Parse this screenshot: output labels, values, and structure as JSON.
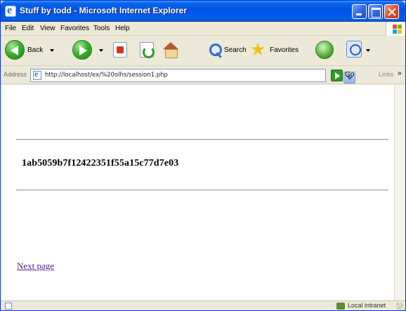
{
  "window": {
    "title": "Stuff by todd - Microsoft Internet Explorer"
  },
  "menu": [
    "File",
    "Edit",
    "View",
    "Favorites",
    "Tools",
    "Help"
  ],
  "toolbar": {
    "back_label": "Back",
    "search_label": "Search",
    "favorites_label": "Favorites"
  },
  "address": {
    "label": "Address",
    "url": "http://localhost/ex/%20olhs/session1.php",
    "go_label": "Go",
    "links_label": "Links"
  },
  "content": {
    "session_hash": "1ab5059b7f12422351f55a15c77d7e03",
    "next_link": "Next page"
  },
  "status": {
    "zone": "Local intranet"
  },
  "colors": {
    "titlebar": "#0054e3",
    "visited_link": "#551a8b",
    "chrome": "#ece9d8"
  }
}
